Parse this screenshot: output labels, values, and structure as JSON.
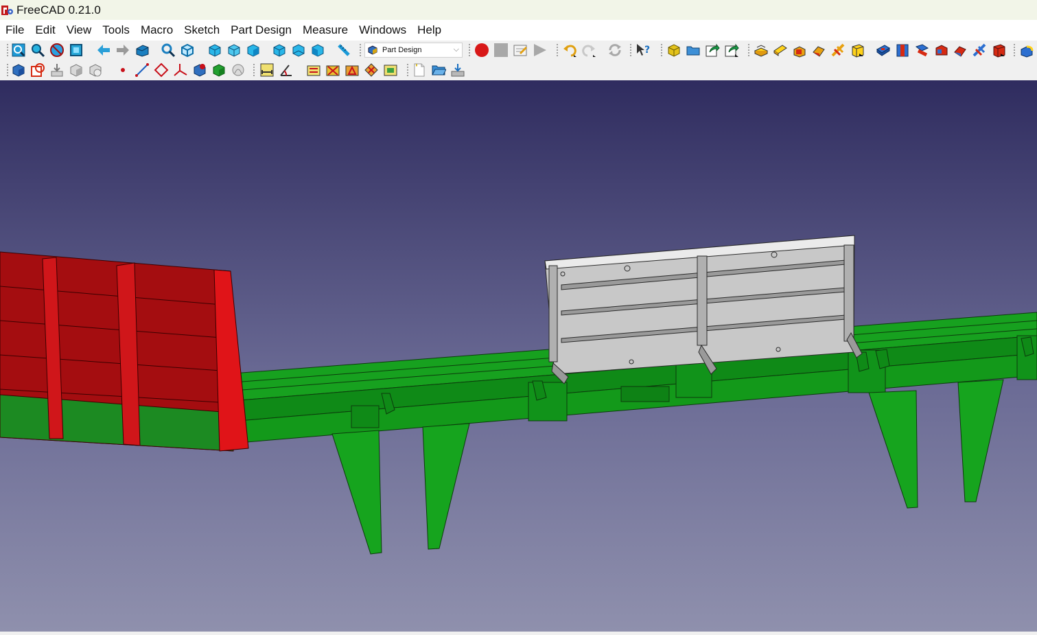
{
  "window": {
    "title": "FreeCAD 0.21.0"
  },
  "menu": [
    "File",
    "Edit",
    "View",
    "Tools",
    "Macro",
    "Sketch",
    "Part Design",
    "Measure",
    "Windows",
    "Help"
  ],
  "workbench": {
    "selected": "Part Design"
  },
  "colors": {
    "background_top": "#2f2c5f",
    "background_bottom": "#8f90ad",
    "green_part": "#13991a",
    "red_part": "#c80f12",
    "grey_part": "#c8c8c8",
    "record_button": "#d81818"
  },
  "toolbar_icons": {
    "row1": [
      "fit-all-icon",
      "fit-selection-icon",
      "draw-style-icon",
      "bounding-box-icon",
      "back-arrow-icon",
      "forward-arrow-icon",
      "view-menu-icon",
      "isometric-icon",
      "axonometric-icon",
      "front-view-icon",
      "top-view-icon",
      "right-view-icon",
      "rear-view-icon",
      "bottom-view-icon",
      "left-view-icon",
      "measure-distance-icon",
      "macro-record-icon",
      "macro-stop-icon",
      "macro-edit-icon",
      "macro-execute-icon",
      "undo-icon",
      "redo-icon",
      "refresh-icon",
      "whats-this-icon",
      "create-part-icon",
      "create-group-icon",
      "create-link-icon",
      "link-actions-icon",
      "pad-icon",
      "revolution-icon",
      "additive-loft-icon",
      "additive-pipe-icon",
      "additive-helix-icon",
      "additive-primitive-icon",
      "pocket-icon",
      "hole-icon",
      "groove-icon",
      "subtractive-loft-icon",
      "subtractive-pipe-icon",
      "subtractive-helix-icon",
      "subtractive-primitive-icon",
      "fillet-icon"
    ],
    "row2": [
      "create-body-icon",
      "create-sketch-icon",
      "validate-sketch-icon",
      "shape-binder-icon",
      "clone-icon",
      "datum-point-icon",
      "datum-line-icon",
      "datum-plane-icon",
      "local-coordinate-system-icon",
      "sub-shape-binder-icon",
      "subshape-icon",
      "bounding-sphere-icon",
      "measure-linear-icon",
      "measure-angular-icon",
      "toggle-all-icon",
      "toggle-3d-icon",
      "toggle-delta-icon",
      "clear-all-icon",
      "refresh-measure-icon",
      "new-file-icon",
      "open-file-icon",
      "save-file-icon"
    ]
  }
}
